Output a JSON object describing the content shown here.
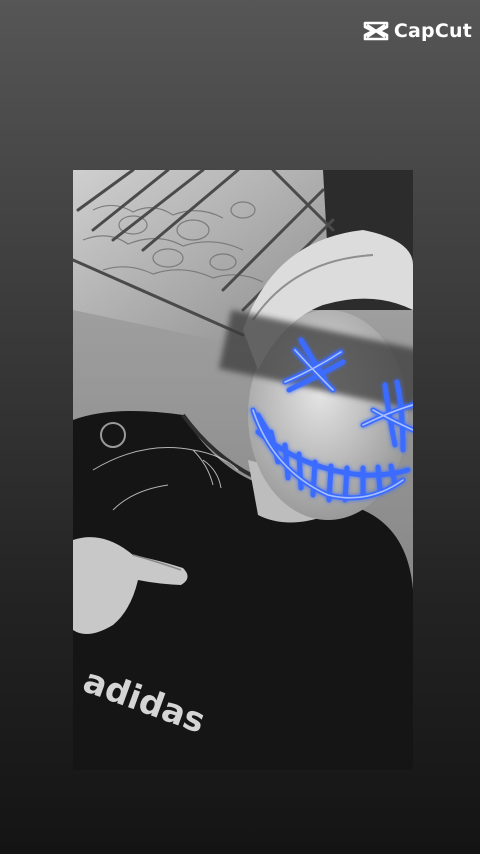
{
  "watermark": {
    "brand_name": "CapCut",
    "icon": "capcut-logo-icon"
  },
  "photo": {
    "subject_icon": "photo-subject",
    "mask_overlay_icon": "neon-purge-mask-icon",
    "accent_color": "#3b6cff",
    "glow_color": "#6f96ff",
    "shirt_text": "adidas"
  }
}
